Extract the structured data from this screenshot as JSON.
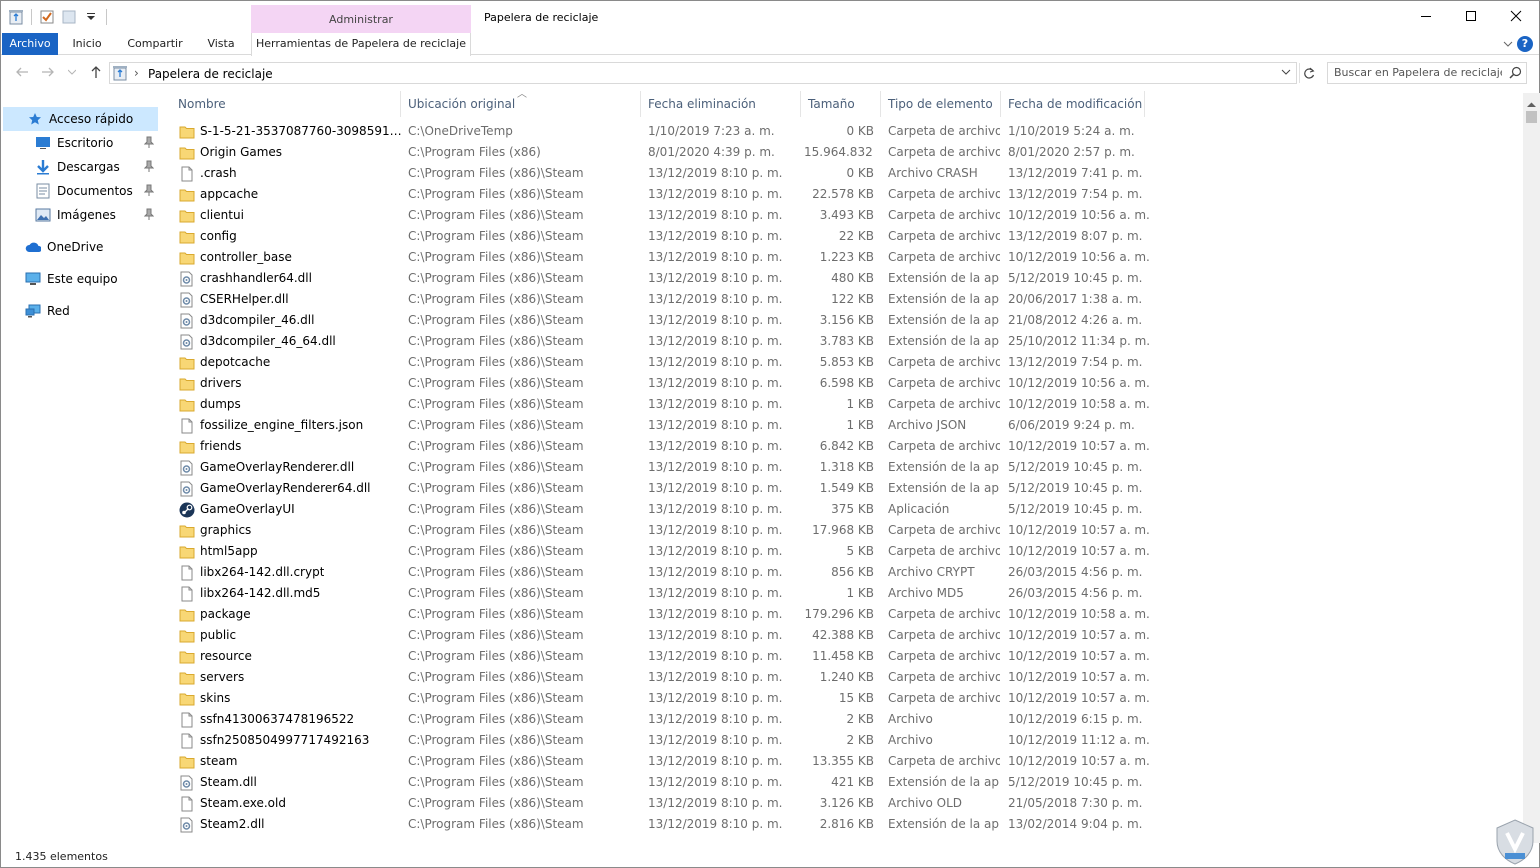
{
  "window": {
    "title": "Papelera de reciclaje",
    "context_group": "Administrar"
  },
  "ribbon": {
    "tabs": [
      {
        "label": "Archivo"
      },
      {
        "label": "Inicio"
      },
      {
        "label": "Compartir"
      },
      {
        "label": "Vista"
      },
      {
        "label": "Herramientas de Papelera de reciclaje"
      }
    ]
  },
  "address": {
    "path": "Papelera de reciclaje",
    "search_placeholder": "Buscar en Papelera de reciclaje"
  },
  "nav": {
    "quick_access": "Acceso rápido",
    "items": [
      {
        "label": "Escritorio",
        "icon": "desktop-icon",
        "pinned": true
      },
      {
        "label": "Descargas",
        "icon": "download-icon",
        "pinned": true
      },
      {
        "label": "Documentos",
        "icon": "documents-icon",
        "pinned": true
      },
      {
        "label": "Imágenes",
        "icon": "pictures-icon",
        "pinned": true
      }
    ],
    "onedrive": "OneDrive",
    "this_pc": "Este equipo",
    "network": "Red"
  },
  "columns": {
    "name": "Nombre",
    "location": "Ubicación original",
    "deleted": "Fecha eliminación",
    "size": "Tamaño",
    "type": "Tipo de elemento",
    "modified": "Fecha de modificación"
  },
  "files": [
    {
      "name": "S-1-5-21-3537087760-3098591382-...",
      "icon": "folder",
      "loc": "C:\\OneDriveTemp",
      "del": "1/10/2019 7:23 a. m.",
      "size": "0 KB",
      "type": "Carpeta de archivos",
      "mod": "1/10/2019 5:24 a. m."
    },
    {
      "name": "Origin Games",
      "icon": "folder",
      "loc": "C:\\Program Files (x86)",
      "del": "8/01/2020 4:39 p. m.",
      "size": "15.964.832 ...",
      "type": "Carpeta de archivos",
      "mod": "8/01/2020 2:57 p. m."
    },
    {
      "name": ".crash",
      "icon": "file",
      "loc": "C:\\Program Files (x86)\\Steam",
      "del": "13/12/2019 8:10 p. m.",
      "size": "0 KB",
      "type": "Archivo CRASH",
      "mod": "13/12/2019 7:41 p. m."
    },
    {
      "name": "appcache",
      "icon": "folder",
      "loc": "C:\\Program Files (x86)\\Steam",
      "del": "13/12/2019 8:10 p. m.",
      "size": "22.578 KB",
      "type": "Carpeta de archivos",
      "mod": "13/12/2019 7:54 p. m."
    },
    {
      "name": "clientui",
      "icon": "folder",
      "loc": "C:\\Program Files (x86)\\Steam",
      "del": "13/12/2019 8:10 p. m.",
      "size": "3.493 KB",
      "type": "Carpeta de archivos",
      "mod": "10/12/2019 10:56 a. m."
    },
    {
      "name": "config",
      "icon": "folder",
      "loc": "C:\\Program Files (x86)\\Steam",
      "del": "13/12/2019 8:10 p. m.",
      "size": "22 KB",
      "type": "Carpeta de archivos",
      "mod": "13/12/2019 8:07 p. m."
    },
    {
      "name": "controller_base",
      "icon": "folder",
      "loc": "C:\\Program Files (x86)\\Steam",
      "del": "13/12/2019 8:10 p. m.",
      "size": "1.223 KB",
      "type": "Carpeta de archivos",
      "mod": "10/12/2019 10:56 a. m."
    },
    {
      "name": "crashhandler64.dll",
      "icon": "dll",
      "loc": "C:\\Program Files (x86)\\Steam",
      "del": "13/12/2019 8:10 p. m.",
      "size": "480 KB",
      "type": "Extensión de la ap...",
      "mod": "5/12/2019 10:45 p. m."
    },
    {
      "name": "CSERHelper.dll",
      "icon": "dll",
      "loc": "C:\\Program Files (x86)\\Steam",
      "del": "13/12/2019 8:10 p. m.",
      "size": "122 KB",
      "type": "Extensión de la ap...",
      "mod": "20/06/2017 1:38 a. m."
    },
    {
      "name": "d3dcompiler_46.dll",
      "icon": "dll",
      "loc": "C:\\Program Files (x86)\\Steam",
      "del": "13/12/2019 8:10 p. m.",
      "size": "3.156 KB",
      "type": "Extensión de la ap...",
      "mod": "21/08/2012 4:26 a. m."
    },
    {
      "name": "d3dcompiler_46_64.dll",
      "icon": "dll",
      "loc": "C:\\Program Files (x86)\\Steam",
      "del": "13/12/2019 8:10 p. m.",
      "size": "3.783 KB",
      "type": "Extensión de la ap...",
      "mod": "25/10/2012 11:34 p. m."
    },
    {
      "name": "depotcache",
      "icon": "folder",
      "loc": "C:\\Program Files (x86)\\Steam",
      "del": "13/12/2019 8:10 p. m.",
      "size": "5.853 KB",
      "type": "Carpeta de archivos",
      "mod": "13/12/2019 7:54 p. m."
    },
    {
      "name": "drivers",
      "icon": "folder",
      "loc": "C:\\Program Files (x86)\\Steam",
      "del": "13/12/2019 8:10 p. m.",
      "size": "6.598 KB",
      "type": "Carpeta de archivos",
      "mod": "10/12/2019 10:56 a. m."
    },
    {
      "name": "dumps",
      "icon": "folder",
      "loc": "C:\\Program Files (x86)\\Steam",
      "del": "13/12/2019 8:10 p. m.",
      "size": "1 KB",
      "type": "Carpeta de archivos",
      "mod": "10/12/2019 10:58 a. m."
    },
    {
      "name": "fossilize_engine_filters.json",
      "icon": "file",
      "loc": "C:\\Program Files (x86)\\Steam",
      "del": "13/12/2019 8:10 p. m.",
      "size": "1 KB",
      "type": "Archivo JSON",
      "mod": "6/06/2019 9:24 p. m."
    },
    {
      "name": "friends",
      "icon": "folder",
      "loc": "C:\\Program Files (x86)\\Steam",
      "del": "13/12/2019 8:10 p. m.",
      "size": "6.842 KB",
      "type": "Carpeta de archivos",
      "mod": "10/12/2019 10:57 a. m."
    },
    {
      "name": "GameOverlayRenderer.dll",
      "icon": "dll",
      "loc": "C:\\Program Files (x86)\\Steam",
      "del": "13/12/2019 8:10 p. m.",
      "size": "1.318 KB",
      "type": "Extensión de la ap...",
      "mod": "5/12/2019 10:45 p. m."
    },
    {
      "name": "GameOverlayRenderer64.dll",
      "icon": "dll",
      "loc": "C:\\Program Files (x86)\\Steam",
      "del": "13/12/2019 8:10 p. m.",
      "size": "1.549 KB",
      "type": "Extensión de la ap...",
      "mod": "5/12/2019 10:45 p. m."
    },
    {
      "name": "GameOverlayUI",
      "icon": "steam",
      "loc": "C:\\Program Files (x86)\\Steam",
      "del": "13/12/2019 8:10 p. m.",
      "size": "375 KB",
      "type": "Aplicación",
      "mod": "5/12/2019 10:45 p. m."
    },
    {
      "name": "graphics",
      "icon": "folder",
      "loc": "C:\\Program Files (x86)\\Steam",
      "del": "13/12/2019 8:10 p. m.",
      "size": "17.968 KB",
      "type": "Carpeta de archivos",
      "mod": "10/12/2019 10:57 a. m."
    },
    {
      "name": "html5app",
      "icon": "folder",
      "loc": "C:\\Program Files (x86)\\Steam",
      "del": "13/12/2019 8:10 p. m.",
      "size": "5 KB",
      "type": "Carpeta de archivos",
      "mod": "10/12/2019 10:57 a. m."
    },
    {
      "name": "libx264-142.dll.crypt",
      "icon": "file",
      "loc": "C:\\Program Files (x86)\\Steam",
      "del": "13/12/2019 8:10 p. m.",
      "size": "856 KB",
      "type": "Archivo CRYPT",
      "mod": "26/03/2015 4:56 p. m."
    },
    {
      "name": "libx264-142.dll.md5",
      "icon": "file",
      "loc": "C:\\Program Files (x86)\\Steam",
      "del": "13/12/2019 8:10 p. m.",
      "size": "1 KB",
      "type": "Archivo MD5",
      "mod": "26/03/2015 4:56 p. m."
    },
    {
      "name": "package",
      "icon": "folder",
      "loc": "C:\\Program Files (x86)\\Steam",
      "del": "13/12/2019 8:10 p. m.",
      "size": "179.296 KB",
      "type": "Carpeta de archivos",
      "mod": "10/12/2019 10:58 a. m."
    },
    {
      "name": "public",
      "icon": "folder",
      "loc": "C:\\Program Files (x86)\\Steam",
      "del": "13/12/2019 8:10 p. m.",
      "size": "42.388 KB",
      "type": "Carpeta de archivos",
      "mod": "10/12/2019 10:57 a. m."
    },
    {
      "name": "resource",
      "icon": "folder",
      "loc": "C:\\Program Files (x86)\\Steam",
      "del": "13/12/2019 8:10 p. m.",
      "size": "11.458 KB",
      "type": "Carpeta de archivos",
      "mod": "10/12/2019 10:57 a. m."
    },
    {
      "name": "servers",
      "icon": "folder",
      "loc": "C:\\Program Files (x86)\\Steam",
      "del": "13/12/2019 8:10 p. m.",
      "size": "1.240 KB",
      "type": "Carpeta de archivos",
      "mod": "10/12/2019 10:57 a. m."
    },
    {
      "name": "skins",
      "icon": "folder",
      "loc": "C:\\Program Files (x86)\\Steam",
      "del": "13/12/2019 8:10 p. m.",
      "size": "15 KB",
      "type": "Carpeta de archivos",
      "mod": "10/12/2019 10:57 a. m."
    },
    {
      "name": "ssfn41300637478196522",
      "icon": "file",
      "loc": "C:\\Program Files (x86)\\Steam",
      "del": "13/12/2019 8:10 p. m.",
      "size": "2 KB",
      "type": "Archivo",
      "mod": "10/12/2019 6:15 p. m."
    },
    {
      "name": "ssfn2508504997717492163",
      "icon": "file",
      "loc": "C:\\Program Files (x86)\\Steam",
      "del": "13/12/2019 8:10 p. m.",
      "size": "2 KB",
      "type": "Archivo",
      "mod": "10/12/2019 11:12 a. m."
    },
    {
      "name": "steam",
      "icon": "folder",
      "loc": "C:\\Program Files (x86)\\Steam",
      "del": "13/12/2019 8:10 p. m.",
      "size": "13.355 KB",
      "type": "Carpeta de archivos",
      "mod": "10/12/2019 10:57 a. m."
    },
    {
      "name": "Steam.dll",
      "icon": "dll",
      "loc": "C:\\Program Files (x86)\\Steam",
      "del": "13/12/2019 8:10 p. m.",
      "size": "421 KB",
      "type": "Extensión de la ap...",
      "mod": "5/12/2019 10:45 p. m."
    },
    {
      "name": "Steam.exe.old",
      "icon": "file",
      "loc": "C:\\Program Files (x86)\\Steam",
      "del": "13/12/2019 8:10 p. m.",
      "size": "3.126 KB",
      "type": "Archivo OLD",
      "mod": "21/05/2018 7:30 p. m."
    },
    {
      "name": "Steam2.dll",
      "icon": "dll",
      "loc": "C:\\Program Files (x86)\\Steam",
      "del": "13/12/2019 8:10 p. m.",
      "size": "2.816 KB",
      "type": "Extensión de la ap...",
      "mod": "13/02/2014 9:04 p. m."
    }
  ],
  "status": {
    "count": "1.435 elementos"
  }
}
